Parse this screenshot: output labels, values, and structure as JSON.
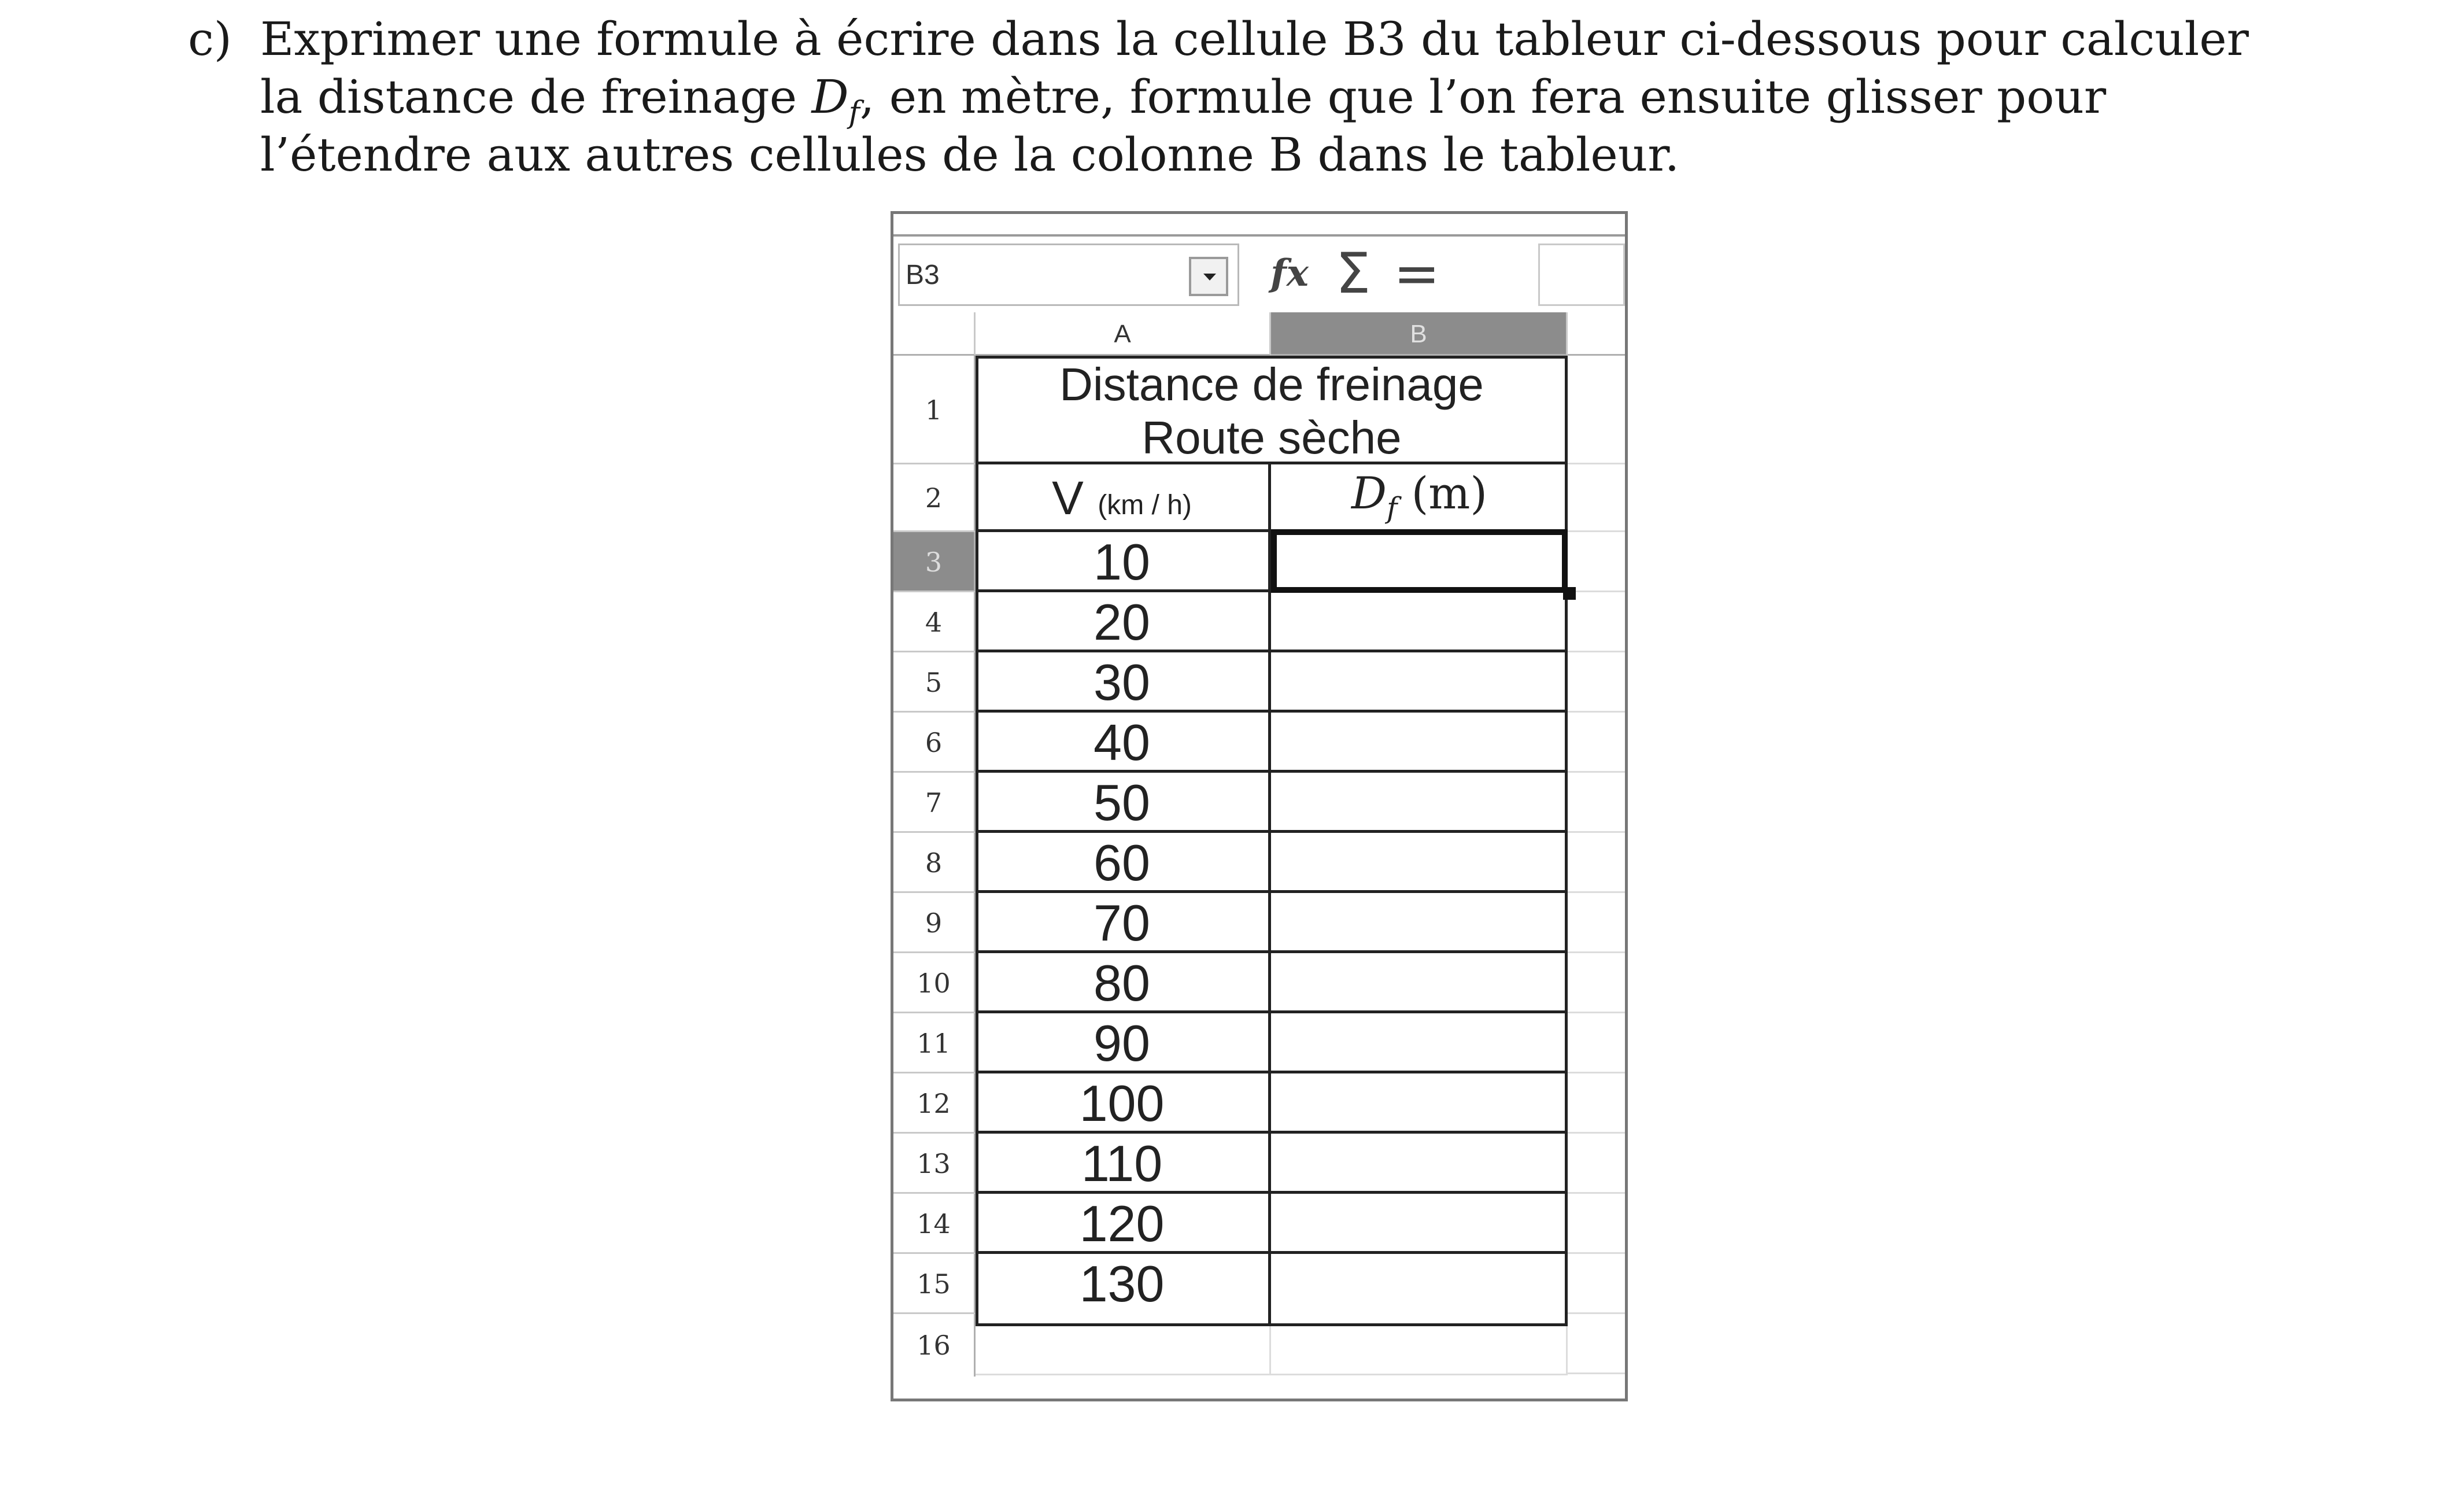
{
  "question": {
    "letter": "c)",
    "text_start": "Exprimer une formule à écrire dans la cellule B3 du tableur ci-dessous pour calculer la distance de freinage ",
    "symbol": "D",
    "symbol_sub": "f",
    "text_end": ", en mètre, formule que l’on fera ensuite glisser pour l’étendre aux autres cellules de la colonne B dans le tableur."
  },
  "toolbar": {
    "name_box": "B3",
    "fx_icon": "fx",
    "sum_icon": "Σ",
    "equals_icon": "=",
    "formula_value": ""
  },
  "columns": [
    "A",
    "B"
  ],
  "selected_column": "B",
  "table": {
    "title_line1": "Distance de freinage",
    "title_line2": "Route sèche",
    "header_a_main": "V",
    "header_a_unit": "(km / h)",
    "header_b_symbol": "D",
    "header_b_sub": "f",
    "header_b_unit": "(m)",
    "speeds": [
      "10",
      "20",
      "30",
      "40",
      "50",
      "60",
      "70",
      "80",
      "90",
      "100",
      "110",
      "120",
      "130"
    ]
  },
  "rows": [
    "1",
    "2",
    "3",
    "4",
    "5",
    "6",
    "7",
    "8",
    "9",
    "10",
    "11",
    "12",
    "13",
    "14",
    "15",
    "16"
  ],
  "selected_row": "3"
}
